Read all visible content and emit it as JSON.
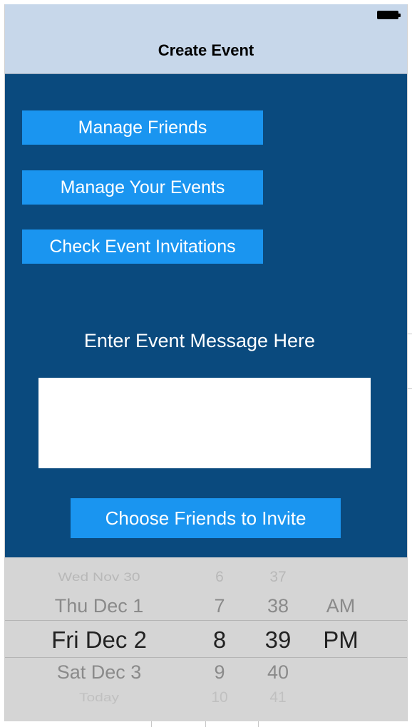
{
  "navbar": {
    "title": "Create Event",
    "battery_icon": "battery-full-icon"
  },
  "menu": {
    "manage_friends": "Manage Friends",
    "manage_events": "Manage Your Events",
    "check_invitations": "Check Event Invitations"
  },
  "message": {
    "label": "Enter Event Message Here",
    "value": ""
  },
  "choose_friends": "Choose Friends to Invite",
  "picker": {
    "rows": [
      {
        "date": "Wed Nov 30",
        "hour": "6",
        "minute": "37",
        "ampm": ""
      },
      {
        "date": "Thu Dec 1",
        "hour": "7",
        "minute": "38",
        "ampm": "AM"
      },
      {
        "date": "Fri Dec 2",
        "hour": "8",
        "minute": "39",
        "ampm": "PM"
      },
      {
        "date": "Sat Dec 3",
        "hour": "9",
        "minute": "40",
        "ampm": ""
      },
      {
        "date": "Today",
        "hour": "10",
        "minute": "41",
        "ampm": ""
      }
    ],
    "selected_index": 2
  },
  "colors": {
    "navbar_bg": "#c7d7ea",
    "main_bg": "#0a4a7e",
    "button_bg": "#1a95f0",
    "picker_bg": "#d5d5d5"
  }
}
